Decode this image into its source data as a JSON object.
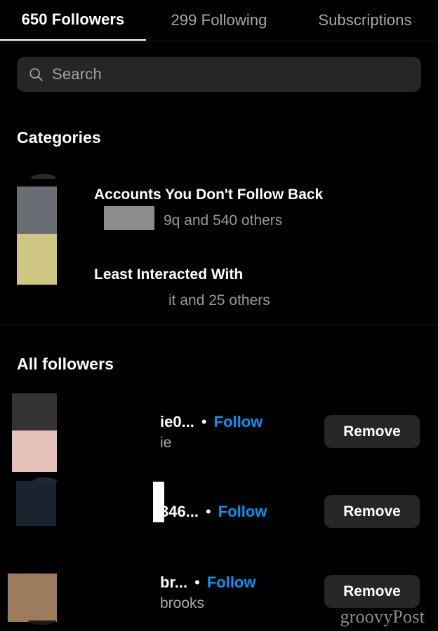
{
  "tabs": [
    {
      "label": "650 Followers",
      "active": true
    },
    {
      "label": "299 Following",
      "active": false
    },
    {
      "label": "Subscriptions",
      "active": false
    }
  ],
  "search": {
    "placeholder": "Search",
    "value": "",
    "icon": "search-icon"
  },
  "categories": {
    "heading": "Categories",
    "items": [
      {
        "title": "Accounts You Don't Follow Back",
        "subtitle": "9q and 540 others"
      },
      {
        "title": "Least Interacted With",
        "subtitle": "it and 25 others"
      }
    ]
  },
  "all_followers": {
    "heading": "All followers",
    "rows": [
      {
        "username": "ie0...",
        "separator": "•",
        "follow_label": "Follow",
        "fullname": "ie",
        "remove_label": "Remove",
        "avatar_top_color": "#333333",
        "avatar_bottom_color": "#e5c0b8"
      },
      {
        "username": "346...",
        "separator": "•",
        "follow_label": "Follow",
        "fullname": "",
        "remove_label": "Remove",
        "avatar_top_color": "#1c2330",
        "avatar_bottom_color": "#1c2330"
      },
      {
        "username": "br...",
        "separator": "•",
        "follow_label": "Follow",
        "fullname": "brooks",
        "remove_label": "Remove",
        "avatar_top_color": "#9d7b5d",
        "avatar_bottom_color": "#9d7b5d"
      }
    ]
  },
  "watermark": {
    "text": "groovyPost"
  },
  "colors": {
    "background": "#000000",
    "surface": "#262626",
    "accent_blue": "#0095f6",
    "text_primary": "#ffffff",
    "text_secondary": "#a8a8a8",
    "divider": "#1a1a1a"
  }
}
